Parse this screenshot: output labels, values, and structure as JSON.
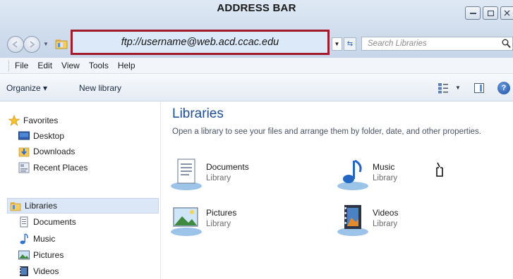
{
  "window": {
    "title": "ADDRESS BAR",
    "address": "ftp://username@web.acd.ccac.edu",
    "search_placeholder": "Search Libraries"
  },
  "menubar": {
    "items": [
      "File",
      "Edit",
      "View",
      "Tools",
      "Help"
    ]
  },
  "commandbar": {
    "organize_label": "Organize ▾",
    "new_library_label": "New library"
  },
  "navpane": {
    "favorites_label": "Favorites",
    "favorites": [
      "Desktop",
      "Downloads",
      "Recent Places"
    ],
    "libraries_label": "Libraries",
    "libraries": [
      "Documents",
      "Music",
      "Pictures",
      "Videos"
    ]
  },
  "content": {
    "title": "Libraries",
    "description": "Open a library to see your files and arrange them by folder, date, and other properties.",
    "items": [
      {
        "name": "Documents",
        "type": "Library",
        "icon": "documents-library-icon"
      },
      {
        "name": "Music",
        "type": "Library",
        "icon": "music-library-icon"
      },
      {
        "name": "Pictures",
        "type": "Library",
        "icon": "pictures-library-icon"
      },
      {
        "name": "Videos",
        "type": "Library",
        "icon": "videos-library-icon"
      }
    ]
  },
  "colors": {
    "address_highlight_border": "#a01c2c",
    "heading_blue": "#1e4d92",
    "selected_row": "#dbe7f6"
  }
}
